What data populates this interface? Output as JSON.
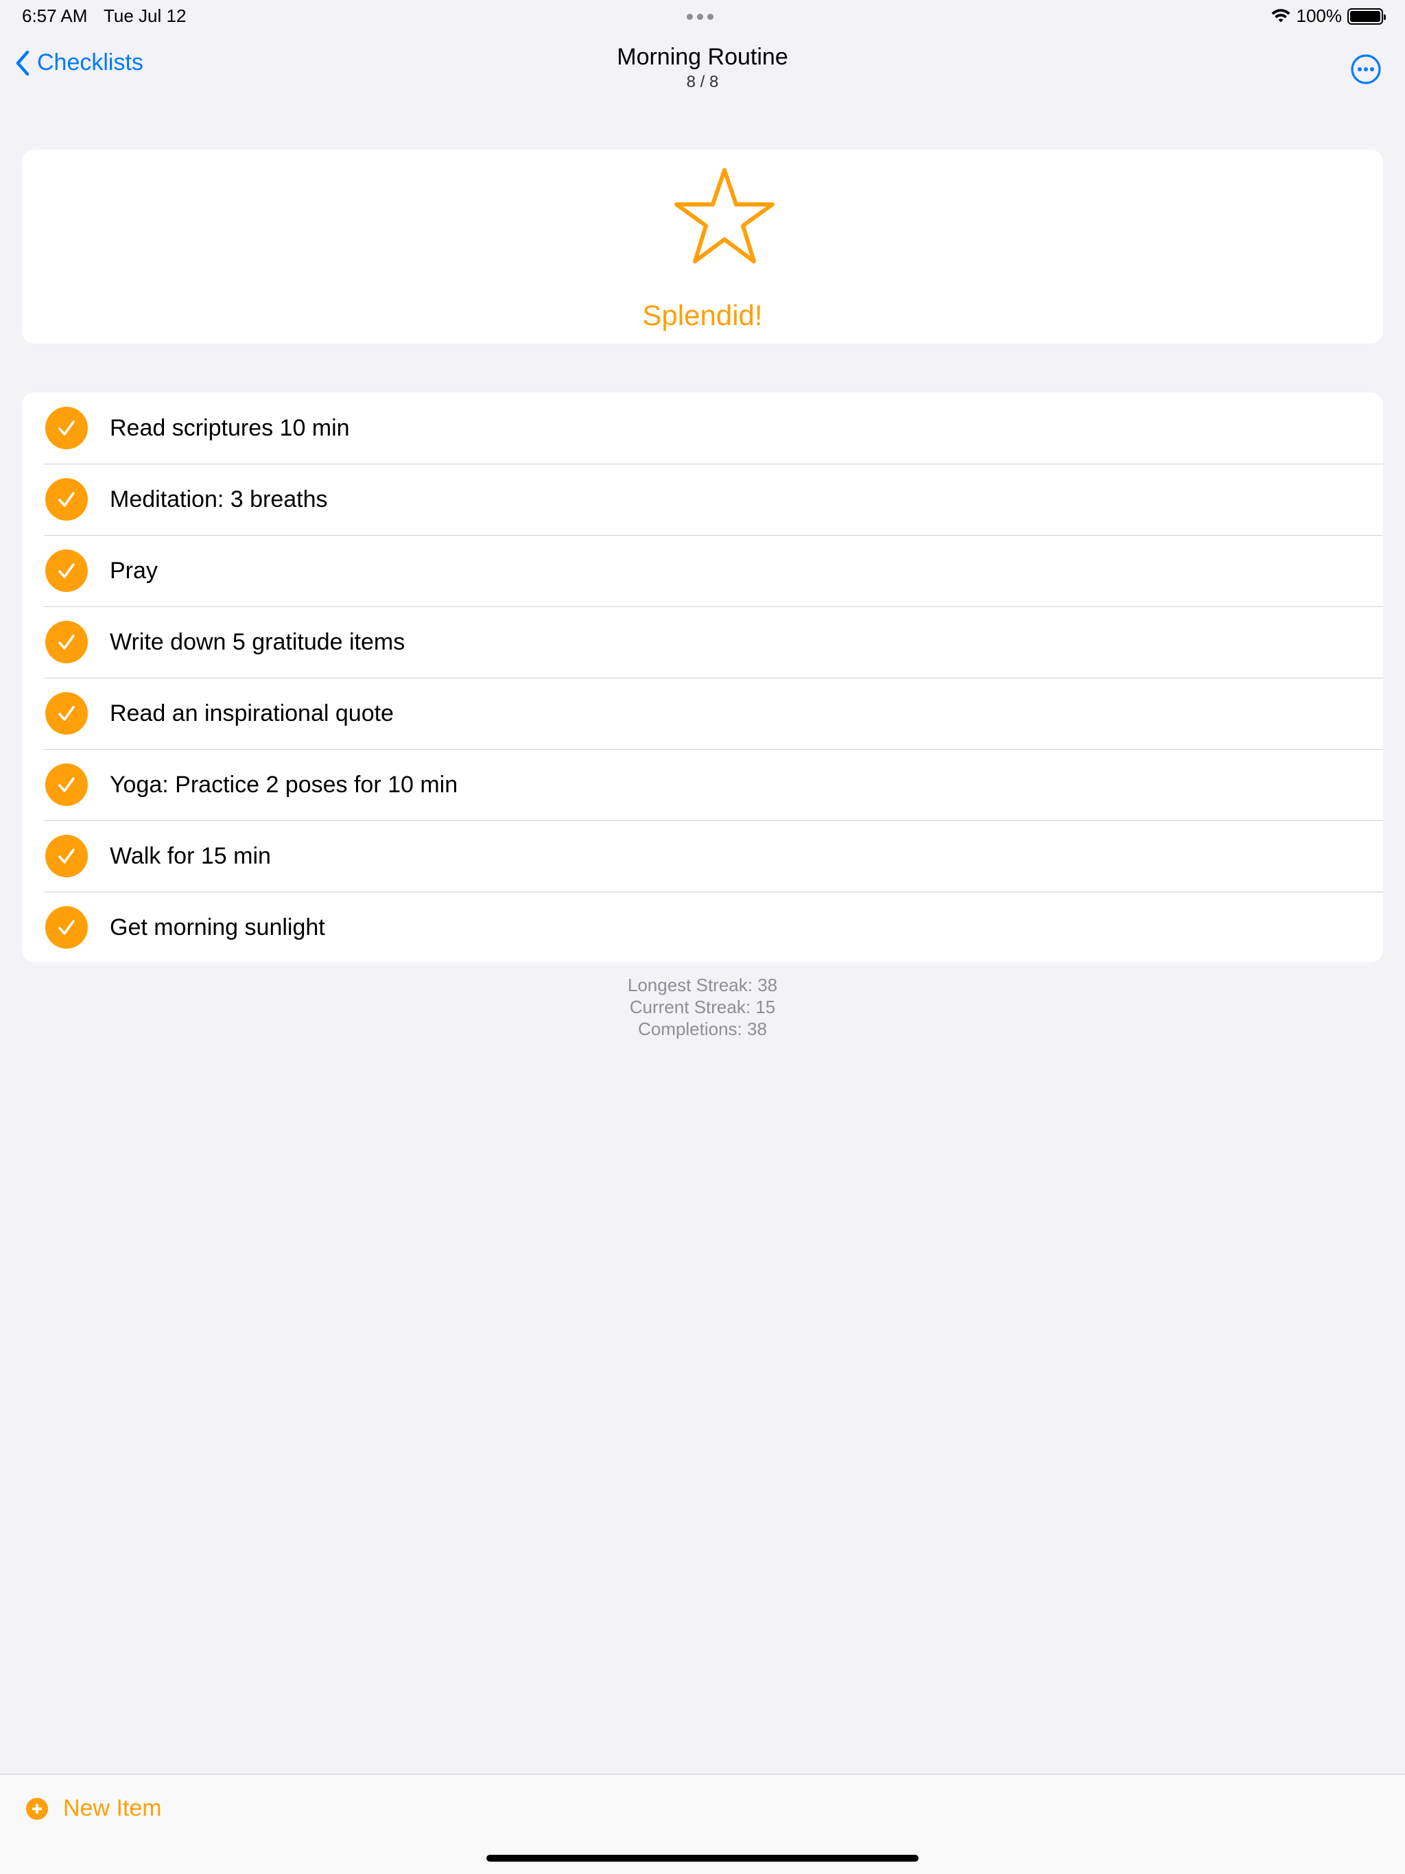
{
  "status_bar": {
    "time": "6:57 AM",
    "date": "Tue Jul 12",
    "battery": "100%",
    "wifi_icon": "wifi-icon",
    "battery_icon": "battery-icon"
  },
  "nav": {
    "back_label": "Checklists",
    "title": "Morning Routine",
    "subtitle": "8 / 8",
    "more_icon": "ellipsis-circle-icon"
  },
  "reward": {
    "icon": "star-icon",
    "text": "Splendid!"
  },
  "checklist": {
    "items": [
      {
        "label": "Read scriptures 10 min",
        "checked": true
      },
      {
        "label": "Meditation: 3 breaths",
        "checked": true
      },
      {
        "label": "Pray",
        "checked": true
      },
      {
        "label": "Write down 5 gratitude items",
        "checked": true
      },
      {
        "label": "Read an inspirational quote",
        "checked": true
      },
      {
        "label": "Yoga: Practice 2 poses for 10 min",
        "checked": true
      },
      {
        "label": "Walk for 15 min",
        "checked": true
      },
      {
        "label": "Get morning sunlight",
        "checked": true
      }
    ]
  },
  "stats": {
    "longest_streak": "Longest Streak: 38",
    "current_streak": "Current Streak: 15",
    "completions": "Completions: 38"
  },
  "toolbar": {
    "new_item_label": "New Item"
  },
  "colors": {
    "accent": "#ff9f0a",
    "link": "#007aff",
    "background": "#f2f2f7"
  }
}
